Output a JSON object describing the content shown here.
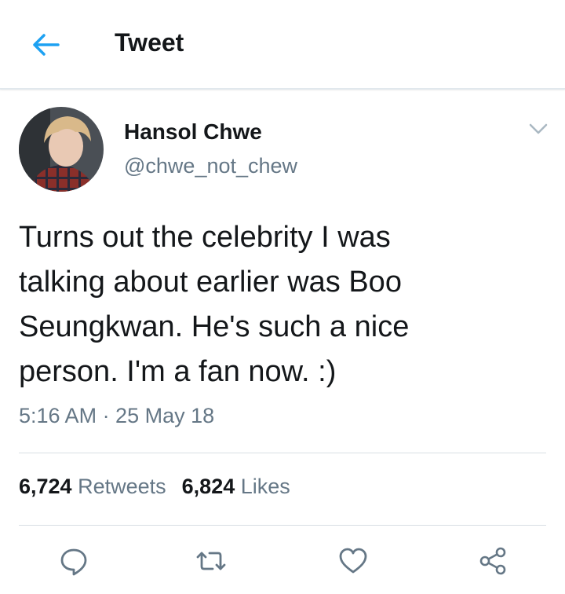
{
  "header": {
    "title": "Tweet",
    "back_icon": "arrow-left-icon",
    "accent_color": "#1da1f2"
  },
  "tweet": {
    "author_name": "Hansol Chwe",
    "author_handle": "@chwe_not_chew",
    "text": "Turns out the celebrity I was\ntalking about earlier was Boo\nSeungkwan. He's such a nice\nperson. I'm a fan now. :)",
    "timestamp": "5:16 AM · 25 May 18",
    "more_icon": "chevron-down-icon"
  },
  "stats": {
    "retweets_count": "6,724",
    "retweets_label": "Retweets",
    "likes_count": "6,824",
    "likes_label": "Likes"
  },
  "actions": [
    {
      "name": "reply",
      "icon": "speech-bubble-icon"
    },
    {
      "name": "retweet",
      "icon": "retweet-icon"
    },
    {
      "name": "like",
      "icon": "heart-icon"
    },
    {
      "name": "share",
      "icon": "share-icon"
    }
  ],
  "colors": {
    "text": "#14171a",
    "secondary": "#657786",
    "divider": "#e1e8ed"
  }
}
